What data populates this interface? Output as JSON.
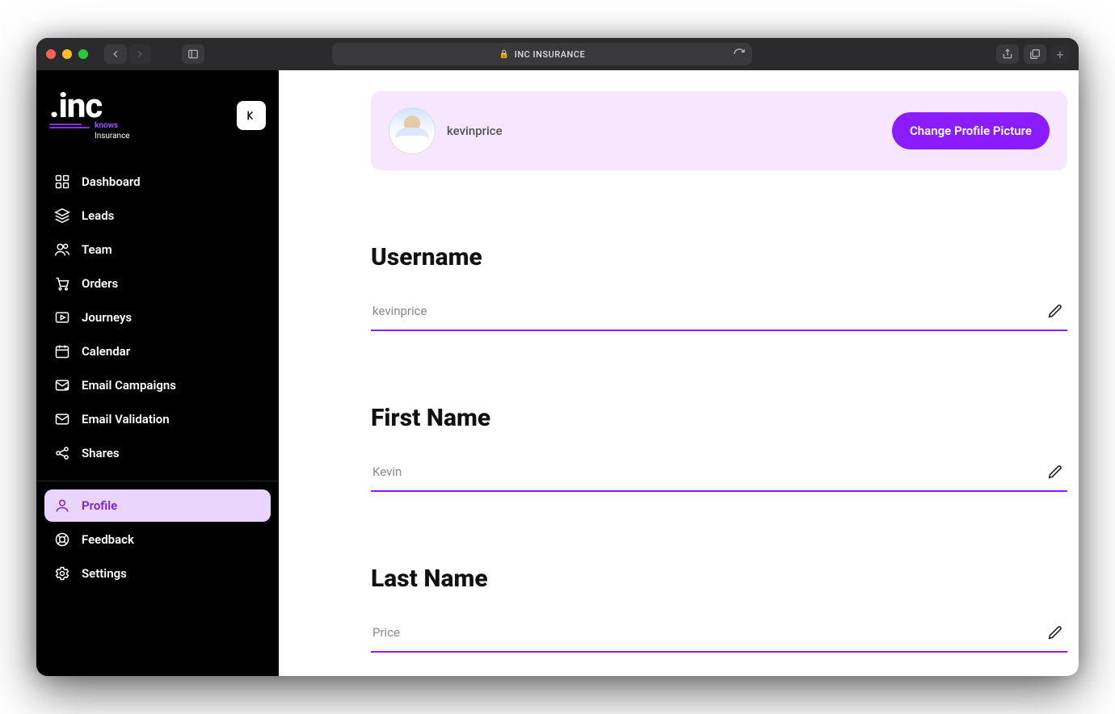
{
  "browser": {
    "url_label": "INC INSURANCE"
  },
  "logo": {
    "text": ".inc",
    "tag1": "knows",
    "tag2": "Insurance"
  },
  "sidebar": {
    "items": [
      {
        "label": "Dashboard",
        "icon": "grid"
      },
      {
        "label": "Leads",
        "icon": "layers"
      },
      {
        "label": "Team",
        "icon": "users"
      },
      {
        "label": "Orders",
        "icon": "cart"
      },
      {
        "label": "Journeys",
        "icon": "play-square"
      },
      {
        "label": "Calendar",
        "icon": "calendar"
      },
      {
        "label": "Email Campaigns",
        "icon": "mail-send"
      },
      {
        "label": "Email Validation",
        "icon": "mail"
      },
      {
        "label": "Shares",
        "icon": "share"
      }
    ],
    "secondary": [
      {
        "label": "Profile",
        "icon": "user",
        "active": true
      },
      {
        "label": "Feedback",
        "icon": "lifebuoy"
      },
      {
        "label": "Settings",
        "icon": "gear"
      }
    ]
  },
  "profile_bar": {
    "username": "kevinprice",
    "button": "Change Profile Picture"
  },
  "fields": [
    {
      "label": "Username",
      "value": "kevinprice"
    },
    {
      "label": "First Name",
      "value": "Kevin"
    },
    {
      "label": "Last Name",
      "value": "Price"
    }
  ]
}
